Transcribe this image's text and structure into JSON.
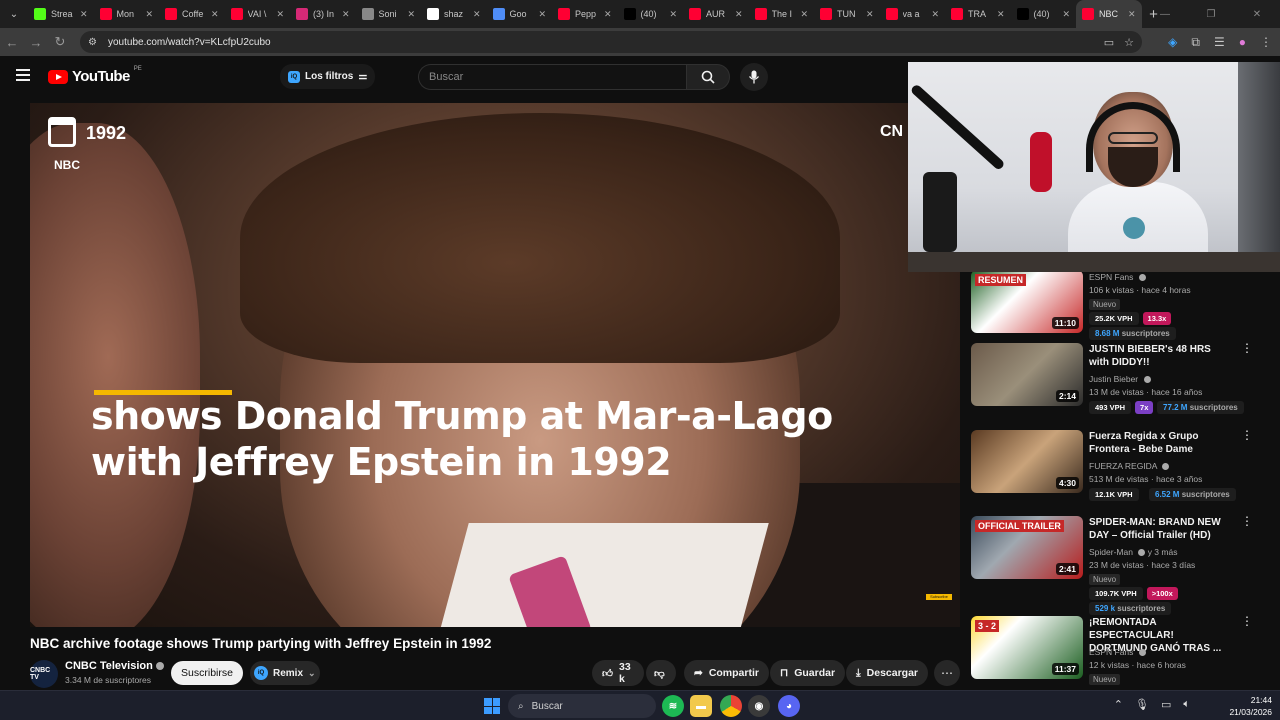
{
  "browser": {
    "tabs": [
      {
        "label": "Strea",
        "icon": "kick-icon",
        "color": "#53fc18",
        "active": false
      },
      {
        "label": "Mon",
        "icon": "youtube-icon",
        "color": "#ff0033",
        "active": false
      },
      {
        "label": "Coffe",
        "icon": "youtube-icon",
        "color": "#ff0033",
        "active": false
      },
      {
        "label": "VAI \\",
        "icon": "youtube-icon",
        "color": "#ff0033",
        "active": false
      },
      {
        "label": "(3) In",
        "icon": "instagram-icon",
        "color": "#d62976",
        "active": false
      },
      {
        "label": "Soni",
        "icon": "sonic-icon",
        "color": "#888888",
        "active": false
      },
      {
        "label": "shaz",
        "icon": "google-icon",
        "color": "#ffffff",
        "active": false
      },
      {
        "label": "Goo",
        "icon": "gemini-icon",
        "color": "#4f8df7",
        "active": false
      },
      {
        "label": "Pepp",
        "icon": "youtube-icon",
        "color": "#ff0033",
        "active": false
      },
      {
        "label": "(40)",
        "icon": "tiktok-icon",
        "color": "#000000",
        "active": false
      },
      {
        "label": "AUR",
        "icon": "youtube-icon",
        "color": "#ff0033",
        "active": false
      },
      {
        "label": "The I",
        "icon": "youtube-icon",
        "color": "#ff0033",
        "active": false
      },
      {
        "label": "TUN",
        "icon": "youtube-icon",
        "color": "#ff0033",
        "active": false
      },
      {
        "label": "va a",
        "icon": "youtube-icon",
        "color": "#ff0033",
        "active": false
      },
      {
        "label": "TRA",
        "icon": "youtube-icon",
        "color": "#ff0033",
        "active": false
      },
      {
        "label": "(40)",
        "icon": "tiktok-icon",
        "color": "#000000",
        "active": false
      },
      {
        "label": "NBC",
        "icon": "youtube-icon",
        "color": "#ff0033",
        "active": true
      }
    ],
    "close_glyph": "✕",
    "new_tab": "+",
    "url": "youtube.com/watch?v=KLcfpU2cubo"
  },
  "youtube": {
    "logo_text": "YouTube",
    "country": "PE",
    "filters_label": "Los filtros",
    "search_placeholder": "Buscar"
  },
  "video": {
    "overlay_year": "1992",
    "overlay_source": "NBC",
    "caption": "shows Donald Trump at Mar-a-Lago with Jeffrey Epstein in 1992",
    "corner_logo": "CN",
    "mini_badge": "Subscribe",
    "title": "NBC archive footage shows Trump partying with Jeffrey Epstein in 1992",
    "channel_name": "CNBC Television",
    "channel_avatar": "CNBC TV",
    "channel_subs": "3.34 M de suscriptores",
    "subscribe_label": "Suscribirse",
    "remix_label": "Remix",
    "likes": "33 k",
    "share_label": "Compartir",
    "save_label": "Guardar",
    "download_label": "Descargar"
  },
  "recommendations": [
    {
      "title": "",
      "channel": "ESPN Fans",
      "meta": "106 k vistas · hace 4 horas",
      "duration": "11:10",
      "badge": "Nuevo",
      "vph": "25.2K VPH",
      "multiplier": "13.3x",
      "multiplier_color": "#c2185b",
      "subs_number": "8.68 M",
      "subs_word": "suscriptores",
      "thumb_text": "RESUMEN"
    },
    {
      "title": "JUSTIN BIEBER's 48 HRS with DIDDY!!",
      "channel": "Justin Bieber",
      "meta": "13 M de vistas · hace 16 años",
      "duration": "2:14",
      "badge": "",
      "vph": "493 VPH",
      "multiplier": "7x",
      "multiplier_color": "#7b3fc4",
      "subs_number": "77.2 M",
      "subs_word": "suscriptores",
      "thumb_text": ""
    },
    {
      "title": "Fuerza Regida x Grupo Frontera - Bebe Dame",
      "channel": "FUERZA REGIDA",
      "meta": "513 M de vistas · hace 3 años",
      "duration": "4:30",
      "badge": "",
      "vph": "12.1K VPH",
      "multiplier": "",
      "multiplier_color": "",
      "subs_number": "6.52 M",
      "subs_word": "suscriptores",
      "thumb_text": ""
    },
    {
      "title": "SPIDER-MAN: BRAND NEW DAY – Official Trailer (HD)",
      "channel": "Spider-Man",
      "channel_suffix": "y 3 más",
      "meta": "23 M de vistas · hace 3 días",
      "duration": "2:41",
      "badge": "Nuevo",
      "vph": "109.7K VPH",
      "multiplier": ">100x",
      "multiplier_color": "#c2185b",
      "subs_number": "529 k",
      "subs_word": "suscriptores",
      "thumb_text": "OFFICIAL TRAILER"
    },
    {
      "title": "¡REMONTADA ESPECTACULAR! DORTMUND GANÓ TRAS ...",
      "channel": "ESPN Fans",
      "meta": "12 k vistas · hace 6 horas",
      "duration": "11:37",
      "badge": "Nuevo",
      "vph": "",
      "multiplier": "",
      "multiplier_color": "",
      "subs_number": "",
      "subs_word": "",
      "thumb_text": "3 - 2"
    }
  ],
  "taskbar": {
    "search_label": "Buscar",
    "time": "21:44",
    "date": "21/03/2026"
  }
}
